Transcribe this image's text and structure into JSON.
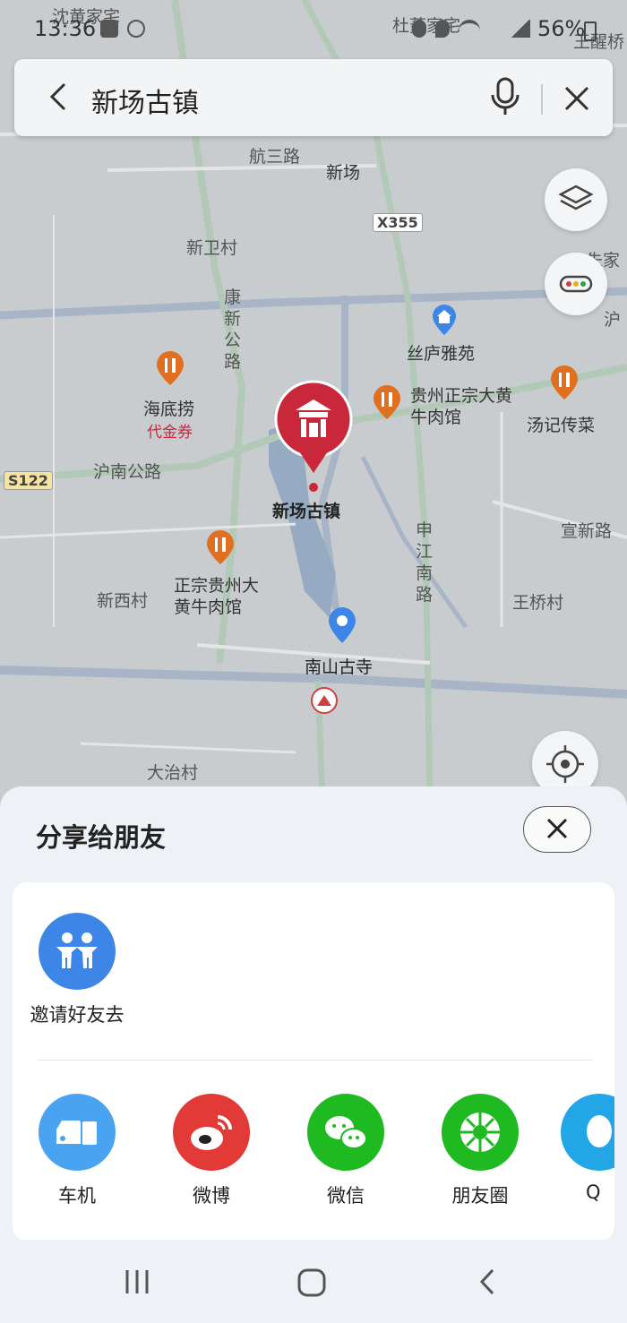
{
  "status_bar": {
    "time": "13:36",
    "battery": "56%"
  },
  "search": {
    "query": "新场古镇"
  },
  "map": {
    "places": {
      "shenhuang": "沈黄家宅",
      "duling": "杜菱家宅",
      "wangqiao_top": "王醒桥",
      "hangsan": "航三路",
      "xinchang": "新场",
      "x355": "X355",
      "xinwei": "新卫村",
      "zhujia": "朱家",
      "kangxin": "康新公路",
      "hu": "沪",
      "siluyayuan": "丝庐雅苑",
      "haidilao": "海底捞",
      "daijinquan": "代金券",
      "guizhou1": "贵州正宗大黄牛肉馆",
      "tangji": "汤记传菜",
      "s122": "S122",
      "hunan": "沪南公路",
      "xinchang_guzhen": "新场古镇",
      "shenjiang": "申江南路",
      "xuanxin": "宣新路",
      "xinxi": "新西村",
      "guizhou2": "正宗贵州大黄牛肉馆",
      "wangqiao": "王桥村",
      "nanshan": "南山古寺",
      "dazhi": "大治村"
    }
  },
  "share_sheet": {
    "title": "分享给朋友",
    "invite": {
      "label": "邀请好友去",
      "color": "#3d86e8"
    },
    "targets": [
      {
        "label": "车机",
        "color": "#4aa3f0",
        "icon": "car-phone-icon"
      },
      {
        "label": "微博",
        "color": "#e23a37",
        "icon": "weibo-icon"
      },
      {
        "label": "微信",
        "color": "#1fb922",
        "icon": "wechat-icon"
      },
      {
        "label": "朋友圈",
        "color": "#1fb922",
        "icon": "moments-icon"
      },
      {
        "label": "Q",
        "color": "#22a6e6",
        "icon": "qq-icon"
      }
    ]
  }
}
